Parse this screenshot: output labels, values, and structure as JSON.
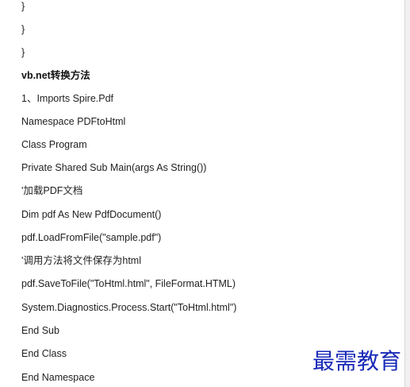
{
  "document": {
    "lines": [
      "}",
      "}",
      "}",
      "vb.net转换方法",
      "1、Imports Spire.Pdf",
      "Namespace PDFtoHtml",
      "Class Program",
      "Private Shared Sub Main(args As String())",
      "'加载PDF文档",
      "Dim pdf As New PdfDocument()",
      "pdf.LoadFromFile(\"sample.pdf\")",
      "'调用方法将文件保存为html",
      "pdf.SaveToFile(\"ToHtml.html\", FileFormat.HTML)",
      "System.Diagnostics.Process.Start(\"ToHtml.html\")",
      "End Sub",
      "End Class",
      "End Namespace"
    ]
  },
  "watermark": {
    "text": "最需教育",
    "color": "#1a2bb8"
  }
}
